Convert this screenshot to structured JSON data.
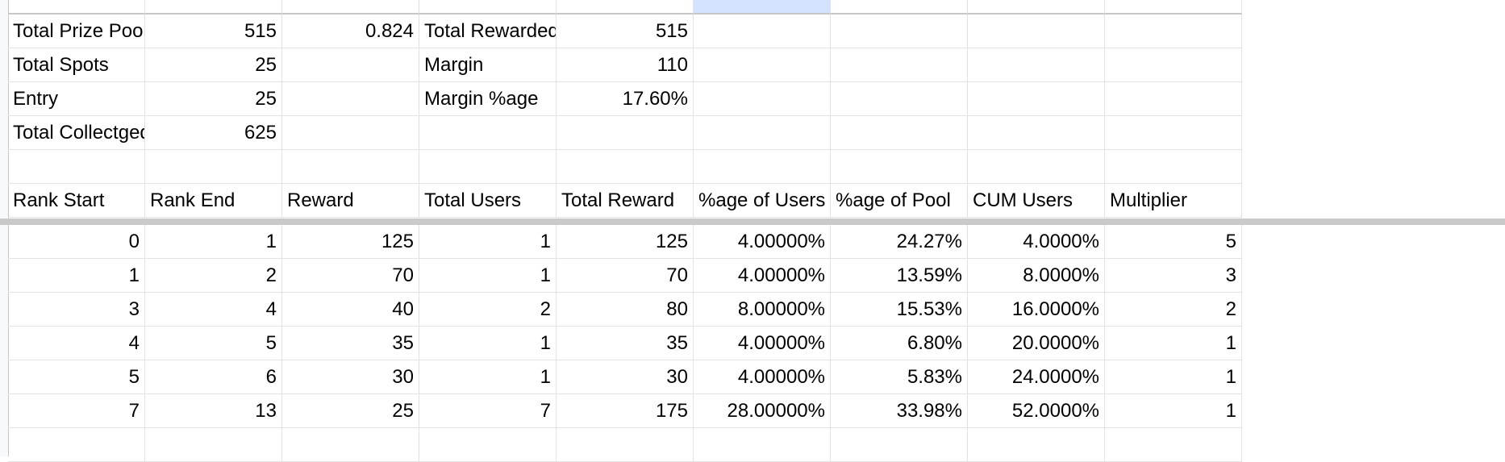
{
  "summary": [
    [
      "Total Prize Pool",
      "515",
      "0.824",
      "Total Rewarded",
      "515",
      "",
      "",
      "",
      ""
    ],
    [
      "Total Spots",
      "25",
      "",
      "Margin",
      "110",
      "",
      "",
      "",
      ""
    ],
    [
      "Entry",
      "25",
      "",
      "Margin %age",
      "17.60%",
      "",
      "",
      "",
      ""
    ],
    [
      "Total Collectged",
      "625",
      "",
      "",
      "",
      "",
      "",
      "",
      ""
    ],
    [
      "",
      "",
      "",
      "",
      "",
      "",
      "",
      "",
      ""
    ]
  ],
  "headers": [
    "Rank Start",
    "Rank End",
    "Reward",
    "Total Users",
    "Total Reward",
    "%age of Users",
    "%age of Pool",
    "CUM Users",
    "Multiplier"
  ],
  "rows": [
    [
      "0",
      "1",
      "125",
      "1",
      "125",
      "4.00000%",
      "24.27%",
      "4.0000%",
      "5"
    ],
    [
      "1",
      "2",
      "70",
      "1",
      "70",
      "4.00000%",
      "13.59%",
      "8.0000%",
      "3"
    ],
    [
      "3",
      "4",
      "40",
      "2",
      "80",
      "8.00000%",
      "15.53%",
      "16.0000%",
      "2"
    ],
    [
      "4",
      "5",
      "35",
      "1",
      "35",
      "4.00000%",
      "6.80%",
      "20.0000%",
      "1"
    ],
    [
      "5",
      "6",
      "30",
      "1",
      "30",
      "4.00000%",
      "5.83%",
      "24.0000%",
      "1"
    ],
    [
      "7",
      "13",
      "25",
      "7",
      "175",
      "28.00000%",
      "33.98%",
      "52.0000%",
      "1"
    ],
    [
      "",
      "",
      "",
      "",
      "",
      "",
      "",
      "",
      ""
    ]
  ],
  "summary_align": [
    [
      "txt",
      "num",
      "num",
      "txt",
      "num",
      "num",
      "num",
      "num",
      "num"
    ],
    [
      "txt",
      "num",
      "num",
      "txt",
      "num",
      "num",
      "num",
      "num",
      "num"
    ],
    [
      "txt",
      "num",
      "num",
      "txt",
      "num",
      "num",
      "num",
      "num",
      "num"
    ],
    [
      "txt",
      "num",
      "num",
      "txt",
      "num",
      "num",
      "num",
      "num",
      "num"
    ],
    [
      "txt",
      "num",
      "num",
      "txt",
      "num",
      "num",
      "num",
      "num",
      "num"
    ]
  ],
  "selection": {
    "color": "#d3e3fd",
    "column_index": 5
  }
}
